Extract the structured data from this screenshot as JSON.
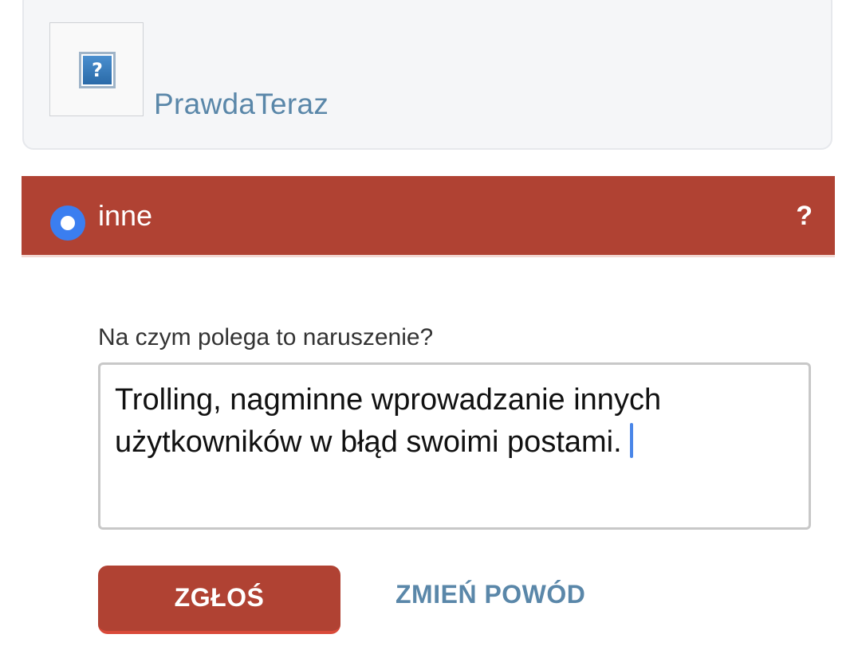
{
  "profile": {
    "username": "PrawdaTeraz",
    "avatar_icon": "question-mark-placeholder",
    "avatar_glyph": "?"
  },
  "reason": {
    "label": "inne",
    "selected": true,
    "help_glyph": "?",
    "bar_color": "#b04233"
  },
  "form": {
    "question": "Na czym polega to naruszenie?",
    "textarea_value": "Trolling, nagminne wprowadzanie innych użytkowników w błąd swoimi postami."
  },
  "actions": {
    "submit_label": "ZGŁOŚ",
    "change_reason_label": "ZMIEŃ POWÓD"
  },
  "colors": {
    "accent_red": "#b04233",
    "link_blue": "#5a87a9",
    "radio_blue": "#3b7ef0"
  }
}
